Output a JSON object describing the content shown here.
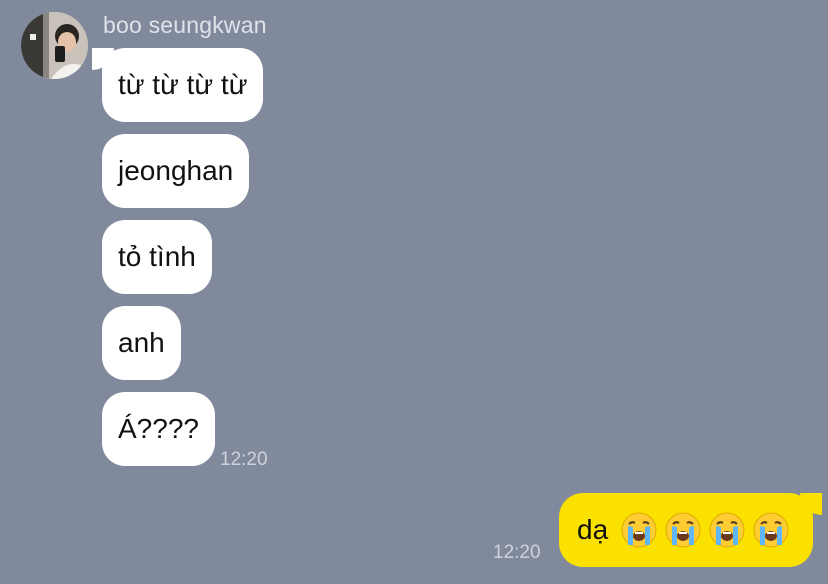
{
  "contact": {
    "name": "boo seungkwan",
    "avatar": "profile-photo"
  },
  "incoming": {
    "messages": [
      {
        "text": "từ từ từ từ"
      },
      {
        "text": "jeonghan"
      },
      {
        "text": "tỏ tình"
      },
      {
        "text": "anh"
      },
      {
        "text": "Á????"
      }
    ],
    "time": "12:20"
  },
  "outgoing": {
    "text": "dạ",
    "emojis": [
      "loudly-crying-face-icon",
      "loudly-crying-face-icon",
      "loudly-crying-face-icon",
      "loudly-crying-face-icon"
    ],
    "time": "12:20"
  },
  "colors": {
    "background": "#818a9c",
    "incoming_bubble": "#ffffff",
    "outgoing_bubble": "#fae100"
  }
}
